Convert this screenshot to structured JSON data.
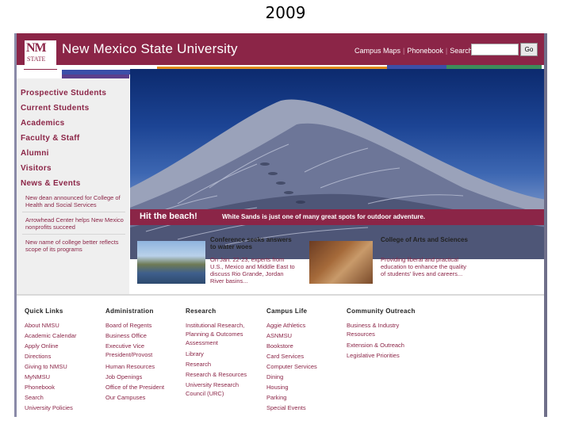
{
  "slide": {
    "year": "2009"
  },
  "header": {
    "logo_nm": "NM",
    "logo_state": "STATE",
    "university_name": "New Mexico State University",
    "links": [
      "Campus Maps",
      "Phonebook",
      "Search"
    ],
    "separator": "|",
    "go_label": "Go"
  },
  "sidebar": {
    "nav": [
      "Prospective Students",
      "Current Students",
      "Academics",
      "Faculty & Staff",
      "Alumni",
      "Visitors",
      "News & Events"
    ],
    "news": [
      "New dean announced for College of Health and Social Services",
      "Arrowhead Center helps New Mexico nonprofits succeed",
      "New name of college better reflects scope of its programs"
    ]
  },
  "hero": {
    "caption_main": "Hit the beach!",
    "caption_sub": "White Sands is just one of many great spots for outdoor adventure."
  },
  "features": [
    {
      "title": "Conference seeks answers to water woes",
      "text": "On Jan. 22-23, experts from U.S., Mexico and Middle East to discuss Rio Grande, Jordan River basins..."
    },
    {
      "title": "College of Arts and Sciences",
      "text": "Providing liberal and practical education to enhance the quality of students' lives and careers..."
    }
  ],
  "footer": {
    "columns": [
      {
        "heading": "Quick Links",
        "links": [
          "About NMSU",
          "Academic Calendar",
          "Apply Online",
          "Directions",
          "Giving to NMSU",
          "MyNMSU",
          "Phonebook",
          "Search",
          "University Policies"
        ]
      },
      {
        "heading": "Administration",
        "links": [
          "Board of Regents",
          "Business Office",
          "Executive Vice",
          "President/Provost",
          "Human Resources",
          "Job Openings",
          "Office of the President",
          "Our Campuses"
        ]
      },
      {
        "heading": "Research",
        "links": [
          "Institutional Research,",
          "Planning & Outcomes",
          "Assessment",
          "Library",
          "Research",
          "Research & Resources",
          "University Research",
          "Council (URC)"
        ]
      },
      {
        "heading": "Campus Life",
        "links": [
          "Aggie Athletics",
          "ASNMSU",
          "Bookstore",
          "Card Services",
          "Computer Services",
          "Dining",
          "Housing",
          "Parking",
          "Special Events"
        ]
      },
      {
        "heading": "Community Outreach",
        "links": [
          "Business & Industry",
          "Resources",
          "Extension & Outreach",
          "Legislative Priorities"
        ]
      }
    ]
  },
  "colors": {
    "brand": "#8b2547",
    "stripe_orange": "#e08a1e",
    "stripe_blue": "#3b4fa8",
    "stripe_green": "#3d8c5a",
    "stripe_purple": "#5b3f8c"
  }
}
